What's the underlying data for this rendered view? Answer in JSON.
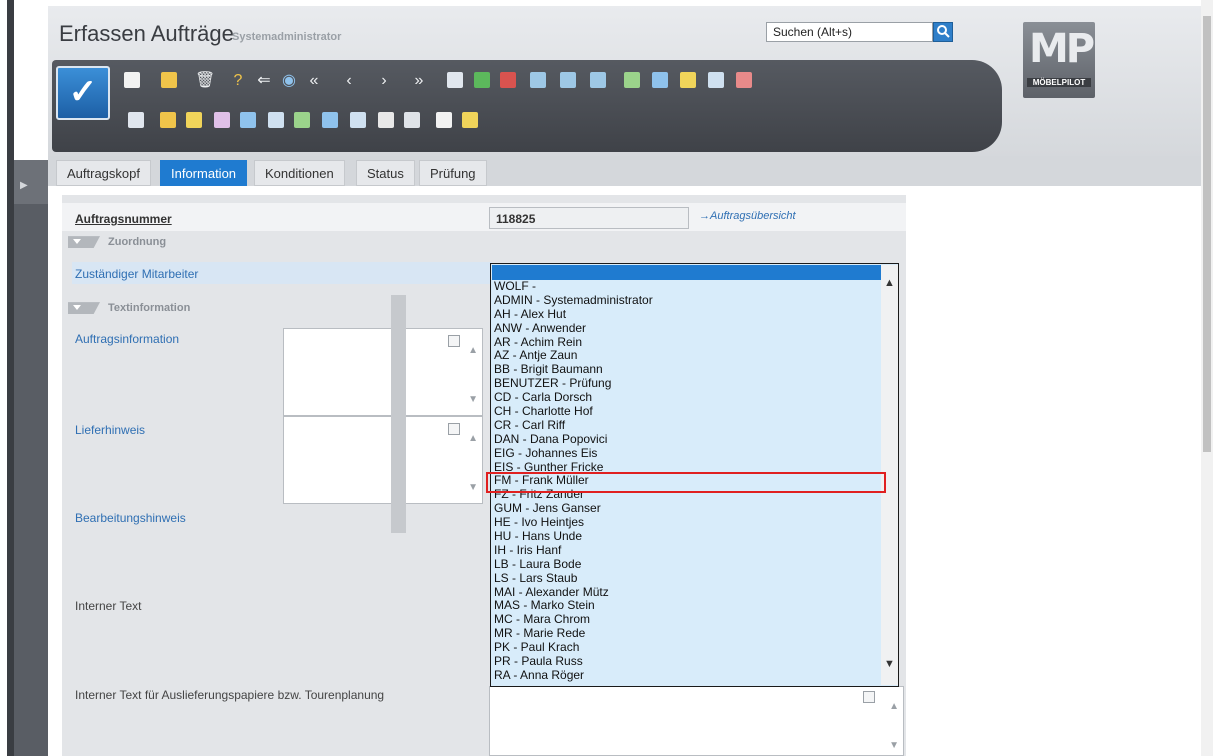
{
  "header": {
    "title": "Erfassen Aufträge",
    "user": "Systemadministrator",
    "search_placeholder": "Suchen (Alt+s)"
  },
  "logo": {
    "mark": "MP",
    "text": "MÖBELPILOT"
  },
  "tabs": [
    {
      "label": "Auftragskopf",
      "active": false
    },
    {
      "label": "Information",
      "active": true
    },
    {
      "label": "Konditionen",
      "active": false
    },
    {
      "label": "Status",
      "active": false
    },
    {
      "label": "Prüfung",
      "active": false
    }
  ],
  "form": {
    "order_label": "Auftragsnummer",
    "order_value": "118825",
    "order_link": "→Auftragsübersicht",
    "section_assignment": "Zuordnung",
    "staff_label": "Zuständiger Mitarbeiter",
    "section_text": "Textinformation",
    "order_info_label": "Auftragsinformation",
    "delivery_note_label": "Lieferhinweis",
    "processing_note_label": "Bearbeitungshinweis",
    "internal_text_label": "Interner Text",
    "internal_delivery_label": "Interner Text für Auslieferungspapiere bzw. Tourenplanung"
  },
  "dropdown": {
    "items": [
      "WOLF -",
      "ADMIN - Systemadministrator",
      "AH - Alex Hut",
      "ANW - Anwender",
      "AR - Achim Rein",
      "AZ - Antje Zaun",
      "BB - Brigit Baumann",
      "BENUTZER - Prüfung",
      "CD - Carla Dorsch",
      "CH - Charlotte Hof",
      "CR - Carl Riff",
      "DAN - Dana Popovici",
      "EIG - Johannes Eis",
      "EIS - Gunther Fricke",
      "FM - Frank Müller",
      "FZ - Fritz Zander",
      "GUM - Jens Ganser",
      "HE - Ivo Heintjes",
      "HU - Hans Unde",
      "IH - Iris Hanf",
      "LB - Laura Bode",
      "LS - Lars Staub",
      "MAI - Alexander Mütz",
      "MAS - Marko Stein",
      "MC - Mara Chrom",
      "MR - Marie Rede",
      "PK - Paul Krach",
      "PR - Paula Russ",
      "RA - Anna Röger"
    ],
    "highlighted": "FM - Frank Müller"
  },
  "colors": {
    "accent": "#1f7bd0",
    "highlight": "#e02020",
    "dropdown_bg": "#d8ecfa"
  }
}
